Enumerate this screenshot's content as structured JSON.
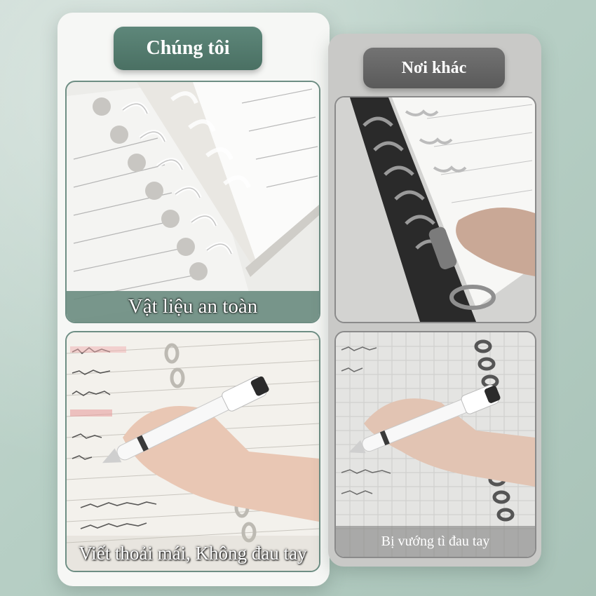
{
  "ours": {
    "badge": "Chúng tôi",
    "top_caption": "Vật liệu an toàn",
    "bottom_caption": "Viết thoải mái, Không đau tay"
  },
  "other": {
    "badge": "Nơi khác",
    "bottom_caption": "Bị vướng tì đau tay"
  },
  "colors": {
    "green_accent": "#4a7063",
    "gray_accent": "#5a5a5a",
    "background": "#b7cfc5"
  }
}
